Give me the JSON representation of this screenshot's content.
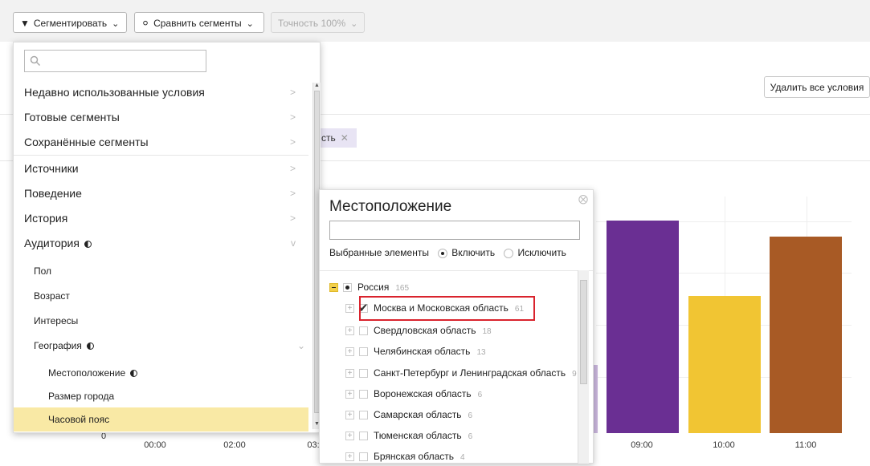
{
  "toolbar": {
    "segment_label": "Сегментировать",
    "compare_label": "Сравнить сегменты",
    "accuracy_label": "Точность 100%"
  },
  "conditions": {
    "delete_all_label": "Удалить все условия",
    "chip_text": "сть"
  },
  "chart_data": {
    "type": "bar",
    "categories": [
      "00:00",
      "02:00",
      "03:",
      "09:00",
      "10:00",
      "11:00"
    ],
    "x_tick_labels": [
      "00:00",
      "02:00",
      "03:",
      "09:00",
      "10:00",
      "11:00"
    ],
    "visible_bars": [
      {
        "label": "09:00",
        "relative_value": 0.93,
        "color": "#6a2f93"
      },
      {
        "label": "10:00",
        "relative_value": 0.6,
        "color": "#f1c533"
      },
      {
        "label": "11:00",
        "relative_value": 0.86,
        "color": "#a85a25"
      }
    ],
    "partial_bar_color": "#c9b6dc",
    "y_tick_partial": "0",
    "grid": true
  },
  "menu": {
    "search_placeholder": "",
    "items": [
      {
        "label": "Недавно использованные условия",
        "arrow": ">"
      },
      {
        "label": "Готовые сегменты",
        "arrow": ">"
      },
      {
        "label": "Сохранённые сегменты",
        "arrow": ">"
      },
      {
        "label": "Источники",
        "arrow": ">"
      },
      {
        "label": "Поведение",
        "arrow": ">"
      },
      {
        "label": "История",
        "arrow": ">"
      },
      {
        "label": "Аудитория",
        "arrow": "v"
      }
    ],
    "audience_sub": [
      "Пол",
      "Возраст",
      "Интересы",
      "География"
    ],
    "geo_sub": [
      "Местоположение",
      "Размер города",
      "Часовой пояс"
    ]
  },
  "location": {
    "title": "Местоположение",
    "input_value": "",
    "selected_label": "Выбранные элементы",
    "include_label": "Включить",
    "exclude_label": "Исключить",
    "tree": [
      {
        "name": "Россия",
        "count": "165"
      },
      {
        "name": "Москва и Московская область",
        "count": "61"
      },
      {
        "name": "Свердловская область",
        "count": "18"
      },
      {
        "name": "Челябинская область",
        "count": "13"
      },
      {
        "name": "Санкт-Петербург и Ленинградская область",
        "count": "9"
      },
      {
        "name": "Воронежская область",
        "count": "6"
      },
      {
        "name": "Самарская область",
        "count": "6"
      },
      {
        "name": "Тюменская область",
        "count": "6"
      },
      {
        "name": "Брянская область",
        "count": "4"
      }
    ]
  }
}
